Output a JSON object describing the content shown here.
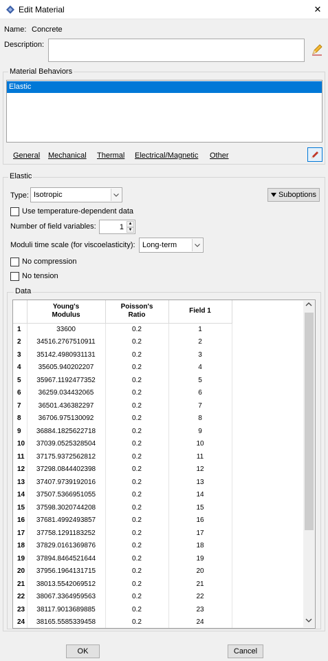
{
  "window": {
    "title": "Edit Material",
    "close_glyph": "✕"
  },
  "name": {
    "label": "Name:",
    "value": "Concrete"
  },
  "description": {
    "label": "Description:",
    "value": ""
  },
  "behaviors": {
    "group_label": "Material Behaviors",
    "items": [
      "Elastic"
    ],
    "selected": "Elastic",
    "menu": [
      "General",
      "Mechanical",
      "Thermal",
      "Electrical/Magnetic",
      "Other"
    ]
  },
  "elastic": {
    "group_label": "Elastic",
    "type_label": "Type:",
    "type_value": "Isotropic",
    "suboptions_label": "Suboptions",
    "temp_dependent_label": "Use temperature-dependent data",
    "temp_dependent_checked": false,
    "field_vars_label": "Number of field variables:",
    "field_vars_value": "1",
    "time_scale_label": "Moduli time scale (for viscoelasticity):",
    "time_scale_value": "Long-term",
    "no_compression_label": "No compression",
    "no_compression_checked": false,
    "no_tension_label": "No tension",
    "no_tension_checked": false
  },
  "data": {
    "group_label": "Data",
    "columns": [
      {
        "line1": "Young's",
        "line2": "Modulus"
      },
      {
        "line1": "Poisson's",
        "line2": "Ratio"
      },
      {
        "line1": "Field 1",
        "line2": ""
      }
    ],
    "rows": [
      [
        "1",
        "33600",
        "0.2",
        "1"
      ],
      [
        "2",
        "34516.2767510911",
        "0.2",
        "2"
      ],
      [
        "3",
        "35142.4980931131",
        "0.2",
        "3"
      ],
      [
        "4",
        "35605.940202207",
        "0.2",
        "4"
      ],
      [
        "5",
        "35967.1192477352",
        "0.2",
        "5"
      ],
      [
        "6",
        "36259.034432065",
        "0.2",
        "6"
      ],
      [
        "7",
        "36501.436382297",
        "0.2",
        "7"
      ],
      [
        "8",
        "36706.975130092",
        "0.2",
        "8"
      ],
      [
        "9",
        "36884.1825622718",
        "0.2",
        "9"
      ],
      [
        "10",
        "37039.0525328504",
        "0.2",
        "10"
      ],
      [
        "11",
        "37175.9372562812",
        "0.2",
        "11"
      ],
      [
        "12",
        "37298.0844402398",
        "0.2",
        "12"
      ],
      [
        "13",
        "37407.9739192016",
        "0.2",
        "13"
      ],
      [
        "14",
        "37507.5366951055",
        "0.2",
        "14"
      ],
      [
        "15",
        "37598.3020744208",
        "0.2",
        "15"
      ],
      [
        "16",
        "37681.4992493857",
        "0.2",
        "16"
      ],
      [
        "17",
        "37758.1291183252",
        "0.2",
        "17"
      ],
      [
        "18",
        "37829.0161369876",
        "0.2",
        "18"
      ],
      [
        "19",
        "37894.8464521644",
        "0.2",
        "19"
      ],
      [
        "20",
        "37956.1964131715",
        "0.2",
        "20"
      ],
      [
        "21",
        "38013.5542069512",
        "0.2",
        "21"
      ],
      [
        "22",
        "38067.3364959563",
        "0.2",
        "22"
      ],
      [
        "23",
        "38117.9013689885",
        "0.2",
        "23"
      ],
      [
        "24",
        "38165.5585339458",
        "0.2",
        "24"
      ]
    ]
  },
  "buttons": {
    "ok": "OK",
    "cancel": "Cancel"
  },
  "colors": {
    "selection": "#0078d7",
    "accent": "#0078d7"
  }
}
